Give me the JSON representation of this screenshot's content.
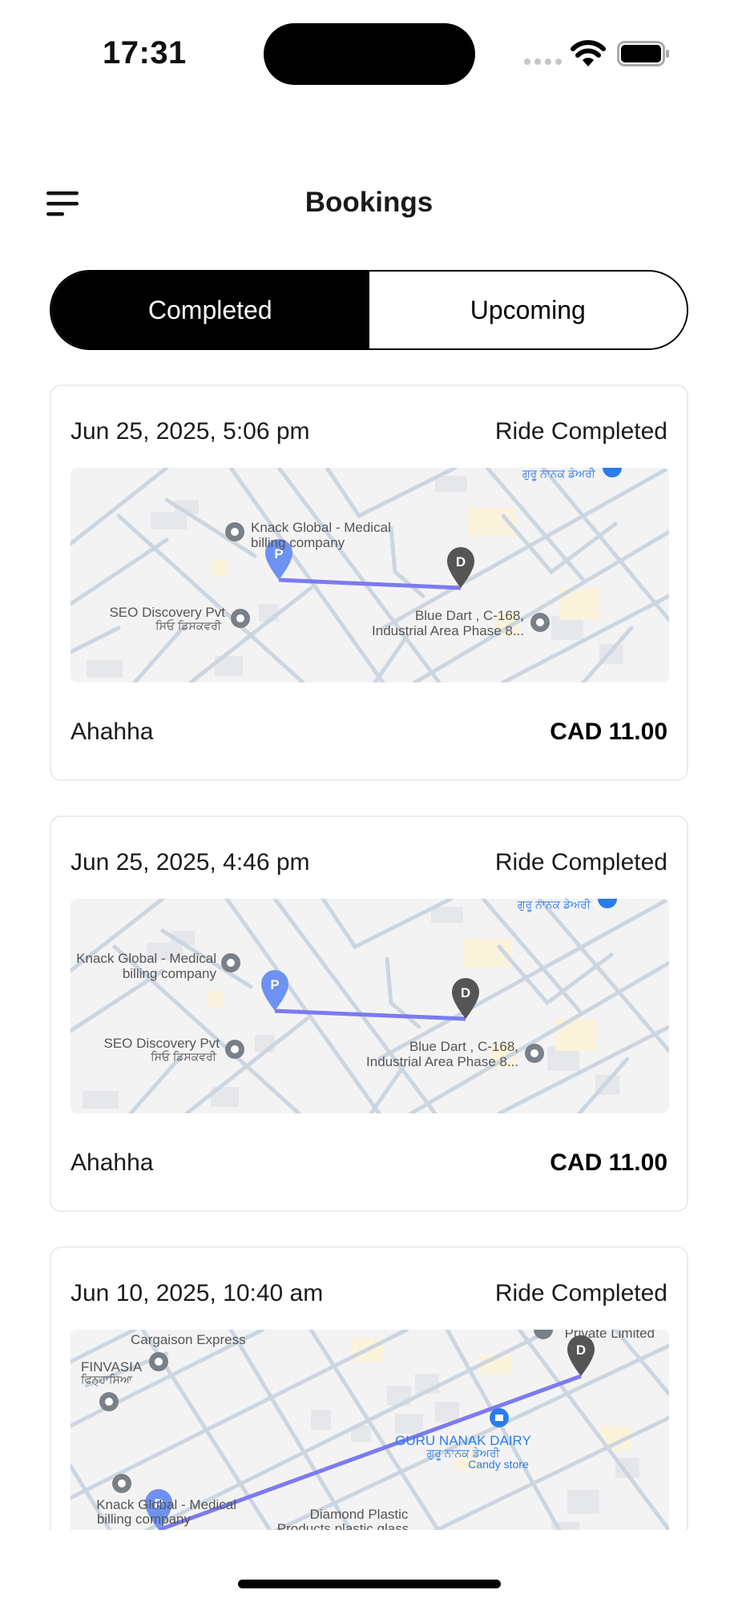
{
  "status_bar": {
    "time": "17:31"
  },
  "header": {
    "title": "Bookings",
    "menu_icon": "hamburger-menu-icon"
  },
  "tabs": [
    {
      "label": "Completed",
      "active": true
    },
    {
      "label": "Upcoming",
      "active": false
    }
  ],
  "bookings": [
    {
      "date": "Jun 25, 2025, 5:06 pm",
      "status": "Ride Completed",
      "name": "Ahahha",
      "price": "CAD 11.00",
      "map": {
        "labels": [
          "Knack Global - Medical",
          "billing company",
          "SEO Discovery Pvt",
          "ਸਿਓ ਡਿਸਕਵਰੀ",
          "Blue Dart , C-168,",
          "Industrial Area Phase 8...",
          "ਗੁਰੂ ਨਾਨਕ ਡੇਅਰੀ"
        ],
        "pickup_marker": "P",
        "drop_marker": "D"
      }
    },
    {
      "date": "Jun 25, 2025, 4:46 pm",
      "status": "Ride Completed",
      "name": "Ahahha",
      "price": "CAD 11.00",
      "map": {
        "labels": [
          "Knack Global - Medical",
          "billing company",
          "SEO Discovery Pvt",
          "ਸਿਓ ਡਿਸਕਵਰੀ",
          "Blue Dart , C-168,",
          "Industrial Area Phase 8...",
          "ਗੁਰੂ ਨਾਨਕ ਡੇਅਰੀ"
        ],
        "pickup_marker": "P",
        "drop_marker": "D"
      }
    },
    {
      "date": "Jun 10, 2025, 10:40 am",
      "status": "Ride Completed",
      "map": {
        "labels": [
          "Cargaison Express",
          "FINVASIA",
          "ਫਿਨ੍ਹਾਸਿਆ",
          "Private Limited",
          "GURU NANAK DAIRY",
          "ਗੁਰੂ ਨਾਨਕ ਡੇਅਰੀ",
          "Candy store",
          "Knack Global - Medical",
          "billing company",
          "Diamond Plastic",
          "Products plastic glass"
        ],
        "pickup_marker": "P",
        "drop_marker": "D"
      }
    }
  ],
  "colors": {
    "route": "#7b7bf0",
    "pickup": "#6e92f2",
    "drop": "#555555",
    "poi": "#7a8088",
    "blue_poi": "#2b7de9"
  }
}
